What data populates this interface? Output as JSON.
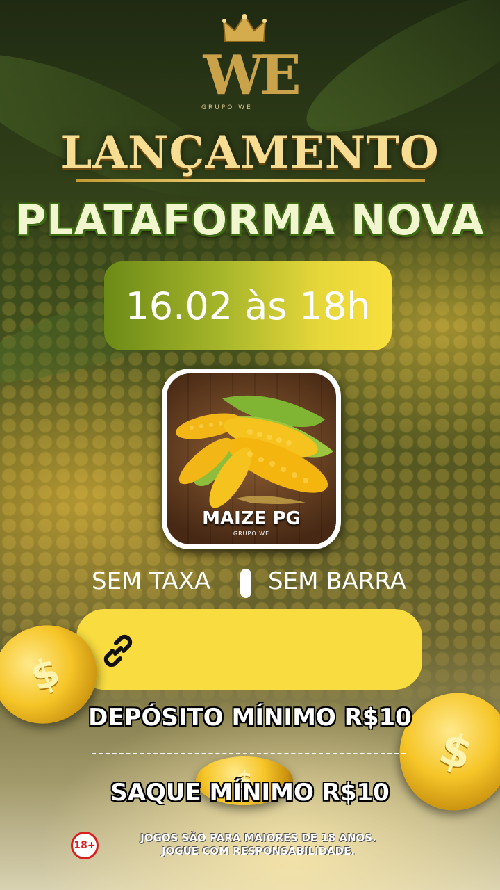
{
  "brand": {
    "monogram": "WE",
    "subtitle": "GRUPO WE"
  },
  "headline": "LANÇAMENTO",
  "subheadline": "PLATAFORMA NOVA",
  "launch_date": "16.02 às 18h",
  "app": {
    "name": "MAIZE PG",
    "publisher": "GRUPO WE"
  },
  "features": {
    "left": "SEM TAXA",
    "right": "SEM BARRA"
  },
  "link_button": {
    "icon": "link-icon",
    "label": ""
  },
  "deposit": "DEPÓSITO MÍNIMO R$10",
  "withdraw": "SAQUE MÍNIMO R$10",
  "age_badge": "18+",
  "disclaimer": {
    "line1": "JOGOS SÃO PARA MAIORES DE 18 ANOS.",
    "line2": "JOGUE COM RESPONSABILIDADE."
  },
  "coin_symbol": "$",
  "colors": {
    "gold": "#f6dd92",
    "pill_yellow": "#f9dc40",
    "green_outline": "#3d6b12",
    "age_red": "#d81e1e"
  }
}
